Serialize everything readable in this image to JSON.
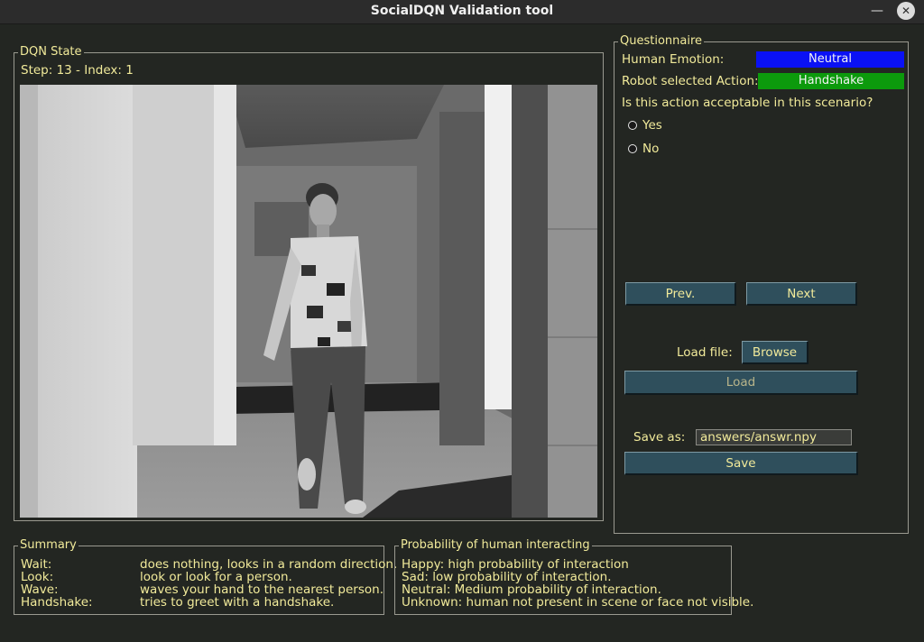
{
  "window": {
    "title": "SocialDQN Validation tool"
  },
  "dqn_state": {
    "legend": "DQN State",
    "step_info": "Step: 13 - Index:  1"
  },
  "questionnaire": {
    "legend": "Questionnaire",
    "emotion_label": "Human Emotion:",
    "emotion_value": "Neutral",
    "emotion_color": "#0a11f5",
    "action_label": "Robot selected Action:",
    "action_value": "Handshake",
    "action_color": "#0c9a0c",
    "question": "Is this action acceptable in this scenario?",
    "options": [
      "Yes",
      "No"
    ],
    "prev_label": "Prev.",
    "next_label": "Next",
    "load_file_label": "Load file:",
    "browse_label": "Browse",
    "load_label": "Load",
    "save_as_label": "Save as:",
    "save_as_value": "answers/answr.npy",
    "save_label": "Save"
  },
  "summary": {
    "legend": "Summary",
    "rows": [
      {
        "action": "Wait:",
        "desc": "does nothing, looks in a random direction."
      },
      {
        "action": "Look:",
        "desc": "look or look for a person."
      },
      {
        "action": "Wave:",
        "desc": "waves your hand to the nearest person."
      },
      {
        "action": "Handshake:",
        "desc": "tries to greet with a handshake."
      }
    ]
  },
  "probability": {
    "legend": "Probability of human interacting",
    "rows": [
      "Happy: high probability of interaction",
      "Sad: low probability of interaction.",
      "Neutral: Medium probability of interaction.",
      "Unknown: human not present in scene or face not visible."
    ]
  }
}
